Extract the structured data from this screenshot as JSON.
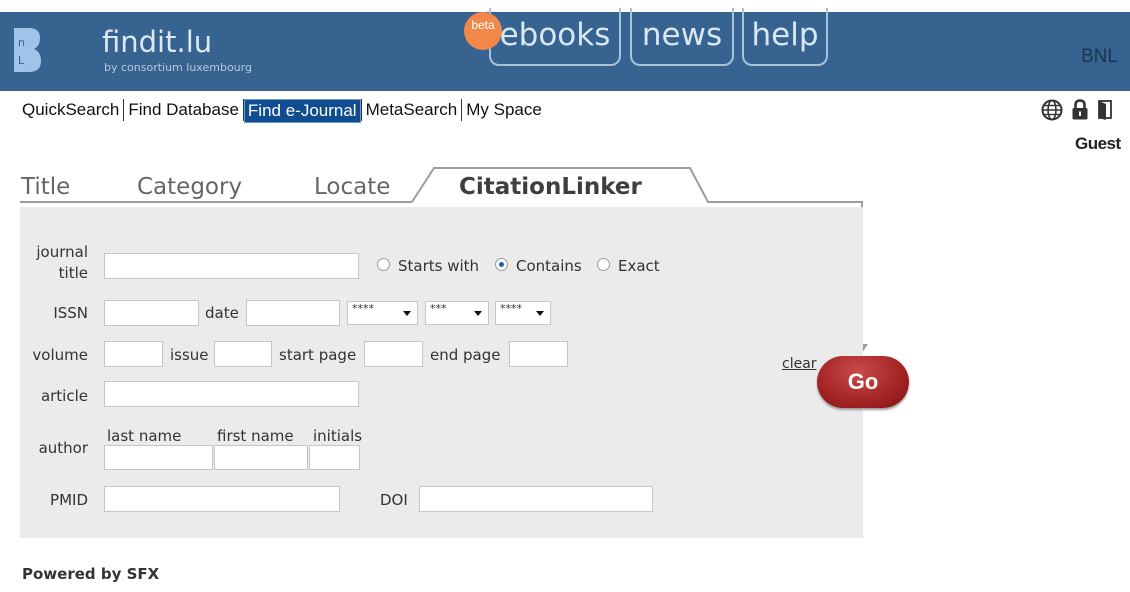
{
  "header": {
    "logo_letter": "B",
    "brand": "findit.lu",
    "brand_sub": "by consortium luxembourg",
    "beta_badge": "beta",
    "links": [
      "ebooks",
      "news",
      "help"
    ],
    "institution": "BNL",
    "colors": {
      "bar": "#36638f",
      "beta": "#f2874a"
    }
  },
  "nav": {
    "items": [
      "QuickSearch",
      "Find Database",
      "Find e-Journal",
      "MetaSearch",
      "My Space"
    ],
    "active": "Find e-Journal",
    "icons": [
      "globe-icon",
      "lock-icon",
      "logout-door-icon"
    ],
    "user": "Guest"
  },
  "tabs": {
    "items": [
      "Title",
      "Category",
      "Locate",
      "CitationLinker"
    ],
    "active": "CitationLinker"
  },
  "form": {
    "journal_title_label_1": "journal",
    "journal_title_label_2": "title",
    "journal_title_value": "",
    "match_options": [
      "Starts with",
      "Contains",
      "Exact"
    ],
    "match_selected": "Contains",
    "issn_label": "ISSN",
    "date_label": "date",
    "year_select": "****",
    "month_select": "***",
    "day_select": "****",
    "volume_label": "volume",
    "issue_label": "issue",
    "start_page_label": "start page",
    "end_page_label": "end page",
    "article_label": "article",
    "author_label": "author",
    "last_name_label": "last name",
    "first_name_label": "first name",
    "initials_label": "initials",
    "pmid_label": "PMID",
    "doi_label": "DOI",
    "clear_label": "clear",
    "go_label": "Go"
  },
  "footer": {
    "powered": "Powered by SFX"
  }
}
